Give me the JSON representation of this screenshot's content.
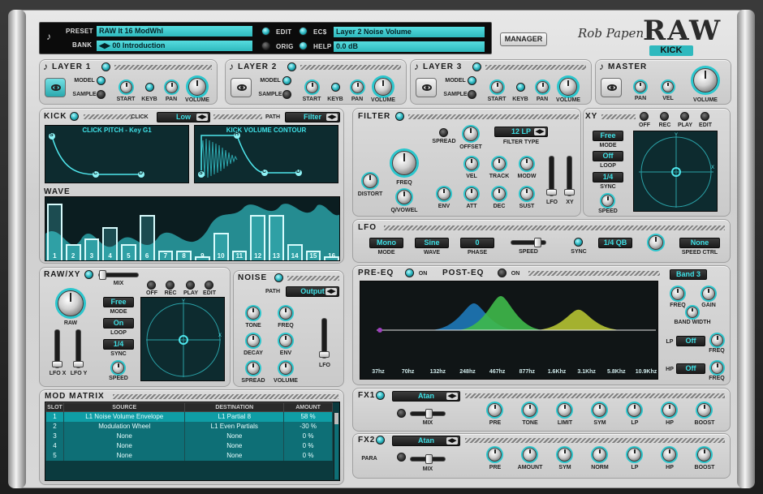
{
  "header": {
    "preset_label": "PRESET",
    "preset_value": "RAW It 16 ModWhl",
    "bank_label": "BANK",
    "bank_value": "00 Introduction",
    "edit_label": "EDIT",
    "orig_label": "ORIG",
    "ecs_label": "EC$",
    "ecs_value": "Layer 2 Noise Volume",
    "help_label": "HELP",
    "help_value": "0.0 dB",
    "bank_arrows": "◀▶"
  },
  "manager_label": "MANAGER",
  "brand": {
    "author": "Rob Papen",
    "product": "RAW",
    "sub": "KICK"
  },
  "layers": [
    {
      "title": "LAYER 1",
      "model": "MODEL",
      "sample": "SAMPLE",
      "start": "START",
      "keyb": "KEYB",
      "pan": "PAN",
      "volume": "VOLUME",
      "active": true
    },
    {
      "title": "LAYER 2",
      "model": "MODEL",
      "sample": "SAMPLE",
      "start": "START",
      "keyb": "KEYB",
      "pan": "PAN",
      "volume": "VOLUME",
      "active": false
    },
    {
      "title": "LAYER 3",
      "model": "MODEL",
      "sample": "SAMPLE",
      "start": "START",
      "keyb": "KEYB",
      "pan": "PAN",
      "volume": "VOLUME",
      "active": false
    }
  ],
  "master": {
    "title": "MASTER",
    "pan": "PAN",
    "vel": "VEL",
    "volume": "VOLUME"
  },
  "kick": {
    "title": "KICK",
    "click_label": "CLICK",
    "click_value": "Low",
    "path_label": "PATH",
    "path_value": "Filter",
    "env1_title": "CLICK PITCH - Key G1",
    "env2_title": "KICK VOLUME CONTOUR",
    "node_s": "S",
    "node_c": "C",
    "node_d": "D",
    "node_h": "H"
  },
  "wave": {
    "title": "WAVE",
    "steps": [
      "1",
      "2",
      "3",
      "4",
      "5",
      "6",
      "7",
      "8",
      "9",
      "10",
      "11",
      "12",
      "13",
      "14",
      "15",
      "16"
    ],
    "bars": [
      1.0,
      0.3,
      0.4,
      0.6,
      0.3,
      0.8,
      0.2,
      0.2,
      0.1,
      0.5,
      0.2,
      0.8,
      0.8,
      0.3,
      0.2,
      0.1
    ]
  },
  "rawxy": {
    "title": "RAW/XY",
    "mix": "MIX",
    "off": "OFF",
    "rec": "REC",
    "play": "PLAY",
    "edit": "EDIT",
    "raw": "RAW",
    "mode_value": "Free",
    "mode": "MODE",
    "loop_value": "On",
    "loop": "LOOP",
    "sync_value": "1/4",
    "sync": "SYNC",
    "speed": "SPEED",
    "lfo_x": "LFO X",
    "lfo_y": "LFO Y",
    "axis_x": "X",
    "axis_y": "Y"
  },
  "noise": {
    "title": "NOISE",
    "path_label": "PATH",
    "path_value": "Output",
    "tone": "TONE",
    "freq": "FREQ",
    "decay": "DECAY",
    "env": "ENV",
    "spread": "SPREAD",
    "volume": "VOLUME",
    "lfo": "LFO"
  },
  "filter": {
    "title": "FILTER",
    "spread": "SPREAD",
    "offset": "OFFSET",
    "type_value": "12 LP",
    "type": "FILTER TYPE",
    "freq": "FREQ",
    "distort": "DISTORT",
    "qvowel": "Q/VOWEL",
    "vel": "VEL",
    "track": "TRACK",
    "modw": "MODW",
    "env": "ENV",
    "att": "ATT",
    "dec": "DEC",
    "sust": "SUST",
    "lfo": "LFO",
    "xy": "XY"
  },
  "xy": {
    "title": "XY",
    "off": "OFF",
    "rec": "REC",
    "play": "PLAY",
    "edit": "EDIT",
    "mode_value": "Free",
    "mode": "MODE",
    "loop_value": "Off",
    "loop": "LOOP",
    "sync_value": "1/4",
    "sync": "SYNC",
    "speed": "SPEED",
    "axis_x": "X",
    "axis_y": "Y"
  },
  "lfo": {
    "title": "LFO",
    "mode_value": "Mono",
    "mode": "MODE",
    "wave_value": "Sine",
    "wave": "WAVE",
    "phase_value": "0",
    "phase": "PHASE",
    "speed": "SPEED",
    "sync": "SYNC",
    "sync_value": "1/4 QB",
    "speedctrl_value": "None",
    "speedctrl": "SPEED CTRL"
  },
  "eq": {
    "pre": "PRE-EQ",
    "post": "POST-EQ",
    "on": "ON",
    "on2": "ON",
    "band_value": "Band 3",
    "freq": "FREQ",
    "gain": "GAIN",
    "bandwidth": "BAND WIDTH",
    "lp": "LP",
    "lp_value": "Off",
    "lp_freq": "FREQ",
    "hp": "HP",
    "hp_value": "Off",
    "hp_freq": "FREQ",
    "freqs": [
      "37hz",
      "70hz",
      "132hz",
      "248hz",
      "467hz",
      "877hz",
      "1.6Khz",
      "3.1Khz",
      "5.8Khz",
      "10.9Khz"
    ],
    "peaks": [
      {
        "pos": 0.38,
        "height": 0.55,
        "color": "#1e78b8"
      },
      {
        "pos": 0.47,
        "height": 0.7,
        "color": "#3fb94a"
      },
      {
        "pos": 0.73,
        "height": 0.42,
        "color": "#b5c232"
      }
    ]
  },
  "modmatrix": {
    "title": "MOD MATRIX",
    "headers": [
      "SLOT",
      "SOURCE",
      "DESTINATION",
      "AMOUNT"
    ],
    "rows": [
      [
        "1",
        "L1 Noise Volume Envelope",
        "L1 Partial 8",
        "58 %"
      ],
      [
        "2",
        "Modulation Wheel",
        "L1 Even Partials",
        "-30 %"
      ],
      [
        "3",
        "None",
        "None",
        "0 %"
      ],
      [
        "4",
        "None",
        "None",
        "0 %"
      ],
      [
        "5",
        "None",
        "None",
        "0 %"
      ]
    ]
  },
  "fx1": {
    "title": "FX1",
    "type": "Atan",
    "mix": "MIX",
    "knobs": [
      "PRE",
      "TONE",
      "LIMIT",
      "SYM",
      "LP",
      "HP",
      "BOOST"
    ]
  },
  "fx2": {
    "title": "FX2",
    "type": "Atan",
    "para": "PARA",
    "mix": "MIX",
    "knobs": [
      "PRE",
      "AMOUNT",
      "SYM",
      "NORM",
      "LP",
      "HP",
      "BOOST"
    ]
  }
}
